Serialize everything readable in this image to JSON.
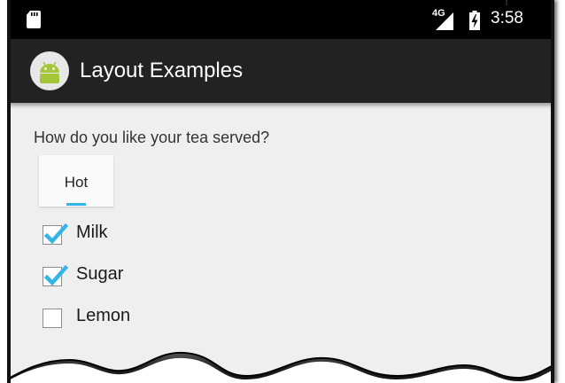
{
  "status_bar": {
    "network_type": "4G",
    "time": "3:58",
    "icons": [
      "sd-card-icon",
      "signal-icon",
      "battery-charging-icon"
    ]
  },
  "action_bar": {
    "app_icon": "android-icon",
    "title": "Layout Examples"
  },
  "form": {
    "question": "How do you like your tea served?",
    "spinner": {
      "selected": "Hot"
    },
    "options": [
      {
        "label": "Milk",
        "checked": true
      },
      {
        "label": "Sugar",
        "checked": true
      },
      {
        "label": "Lemon",
        "checked": false
      }
    ]
  },
  "colors": {
    "accent": "#33b5e5",
    "action_bar": "#222222",
    "status_bar": "#000000",
    "android_green": "#a4c639",
    "background": "#efefef"
  }
}
